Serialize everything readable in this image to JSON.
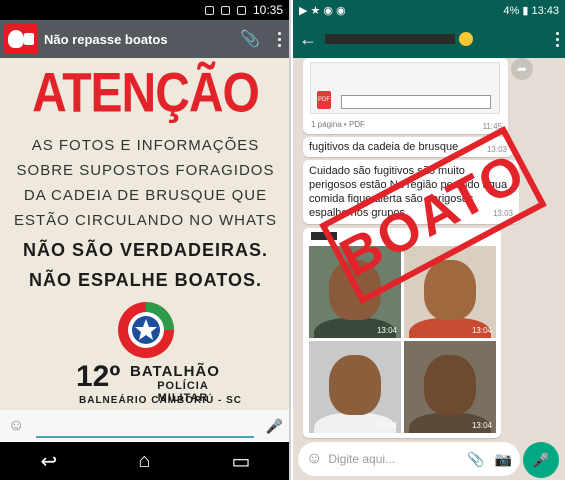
{
  "left": {
    "status_time": "10:35",
    "header_title": "Não repasse boatos",
    "poster": {
      "headline": "ATENÇÃO",
      "info_lines": [
        "AS FOTOS E INFORMAÇÕES",
        "SOBRE SUPOSTOS FORAGIDOS",
        "DA CADEIA DE BRUSQUE QUE",
        "ESTÃO CIRCULANDO NO WHATS"
      ],
      "bold_line_1": "NÃO SÃO VERDADEIRAS.",
      "bold_line_2": "NÃO ESPALHE BOATOS.",
      "battalion_number": "12º",
      "battalion_name": "BATALHÃO",
      "battalion_sub": "POLÍCIA MILITAR",
      "battalion_location": "BALNEÁRIO CAMBORIÚ - SC"
    }
  },
  "right": {
    "status_battery": "4%",
    "status_time": "13:43",
    "pdf_meta": "1 página • PDF",
    "pdf_time": "11:45",
    "msg1_text": "fugitivos da cadeia de brusque",
    "msg1_time": "13:03",
    "msg2_text": "Cuidado são fugitivos são muito perigosos estão  Na região pedindo água  comida fique alerta são perigosos espalhe nos grupos",
    "msg2_time": "13:03",
    "photo_times": [
      "13:04",
      "13:04",
      "13:04",
      "13:04"
    ],
    "stamp": "BOATO",
    "input_placeholder": "Digite aqui..."
  },
  "colors": {
    "poster_red": "#e3232a",
    "whatsapp_green": "#075e54",
    "mic_green": "#00a884"
  }
}
